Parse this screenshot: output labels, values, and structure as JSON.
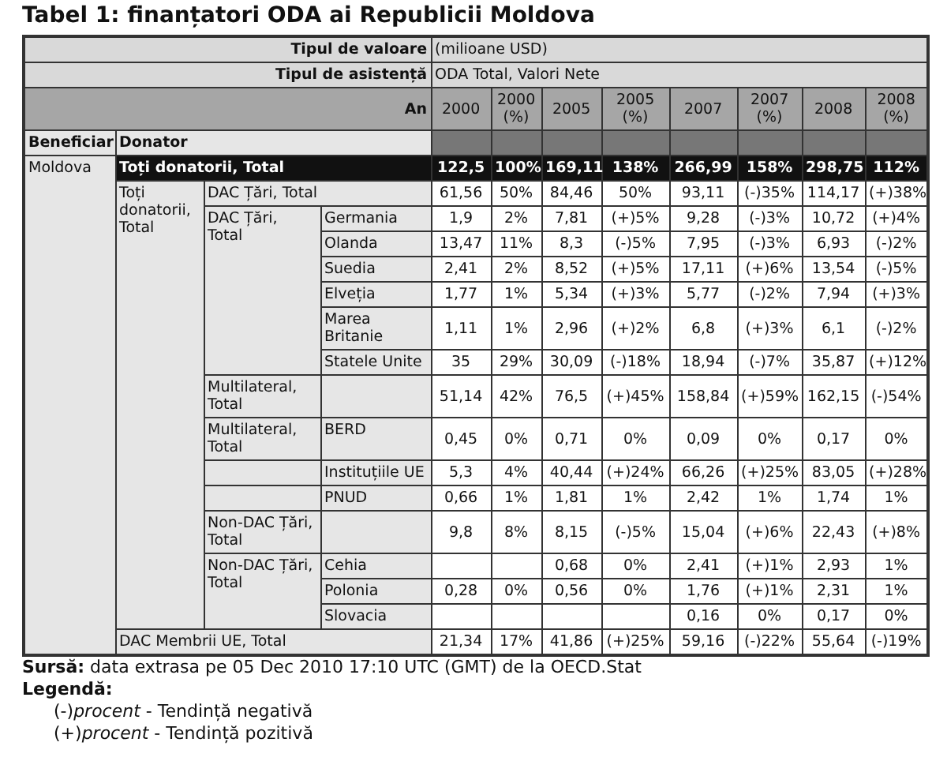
{
  "title": "Tabel 1: finanțatori ODA ai Republicii Moldova",
  "table": {
    "value_type": {
      "label": "Tipul de valoare",
      "value": "(milioane USD)"
    },
    "assistance_type": {
      "label": "Tipul de asistență",
      "value": "ODA Total, Valori Nete"
    },
    "year_label": "An",
    "columns": [
      "2000",
      "2000 (%)",
      "2005",
      "2005 (%)",
      "2007",
      "2007 (%)",
      "2008",
      "2008 (%)"
    ],
    "beneficiary_header": "Beneficiar",
    "donor_header": "Donator",
    "beneficiary": "Moldova",
    "rows": [
      {
        "label": "Toți donatorii, Total",
        "highlighted": true,
        "values": [
          "122,5",
          "100%",
          "169,11",
          "138%",
          "266,99",
          "158%",
          "298,75",
          "112%"
        ]
      },
      {
        "label": "Toți donatorii, Total",
        "highlighted": false,
        "children": [
          {
            "label": "DAC Țări, Total",
            "values": [
              "61,56",
              "50%",
              "84,46",
              "50%",
              "93,11",
              "(-)35%",
              "114,17",
              "(+)38%"
            ]
          },
          {
            "label": "DAC Țări, Total",
            "children": [
              {
                "label": "Germania",
                "values": [
                  "1,9",
                  "2%",
                  "7,81",
                  "(+)5%",
                  "9,28",
                  "(-)3%",
                  "10,72",
                  "(+)4%"
                ]
              },
              {
                "label": "Olanda",
                "values": [
                  "13,47",
                  "11%",
                  "8,3",
                  "(-)5%",
                  "7,95",
                  "(-)3%",
                  "6,93",
                  "(-)2%"
                ]
              },
              {
                "label": "Suedia",
                "values": [
                  "2,41",
                  "2%",
                  "8,52",
                  "(+)5%",
                  "17,11",
                  "(+)6%",
                  "13,54",
                  "(-)5%"
                ]
              },
              {
                "label": "Elveția",
                "values": [
                  "1,77",
                  "1%",
                  "5,34",
                  "(+)3%",
                  "5,77",
                  "(-)2%",
                  "7,94",
                  "(+)3%"
                ]
              },
              {
                "label": "Marea Britanie",
                "values": [
                  "1,11",
                  "1%",
                  "2,96",
                  "(+)2%",
                  "6,8",
                  "(+)3%",
                  "6,1",
                  "(-)2%"
                ]
              },
              {
                "label": "Statele Unite",
                "values": [
                  "35",
                  "29%",
                  "30,09",
                  "(-)18%",
                  "18,94",
                  "(-)7%",
                  "35,87",
                  "(+)12%"
                ]
              }
            ]
          },
          {
            "label": "Multilateral, Total",
            "children": [
              {
                "values": [
                  "51,14",
                  "42%",
                  "76,5",
                  "(+)45%",
                  "158,84",
                  "(+)59%",
                  "162,15",
                  "(-)54%"
                ]
              }
            ]
          },
          {
            "label": "Multilateral, Total",
            "children": [
              {
                "label": "BERD",
                "values": [
                  "0,45",
                  "0%",
                  "0,71",
                  "0%",
                  "0,09",
                  "0%",
                  "0,17",
                  "0%"
                ]
              }
            ]
          },
          {
            "children": [
              {
                "label": "Instituțiile UE",
                "values": [
                  "5,3",
                  "4%",
                  "40,44",
                  "(+)24%",
                  "66,26",
                  "(+)25%",
                  "83,05",
                  "(+)28%"
                ]
              }
            ]
          },
          {
            "children": [
              {
                "label": "PNUD",
                "values": [
                  "0,66",
                  "1%",
                  "1,81",
                  "1%",
                  "2,42",
                  "1%",
                  "1,74",
                  "1%"
                ]
              }
            ]
          },
          {
            "label": "Non-DAC Țări, Total",
            "children": [
              {
                "values": [
                  "9,8",
                  "8%",
                  "8,15",
                  "(-)5%",
                  "15,04",
                  "(+)6%",
                  "22,43",
                  "(+)8%"
                ]
              }
            ]
          },
          {
            "label": "Non-DAC Țări, Total",
            "children": [
              {
                "label": "Cehia",
                "values": [
                  {
                    "kind": "blank"
                  },
                  {
                    "kind": "blank"
                  },
                  "0,68",
                  "0%",
                  "2,41",
                  "(+)1%",
                  "2,93",
                  "1%"
                ]
              },
              {
                "label": "Polonia",
                "values": [
                  "0,28",
                  "0%",
                  "0,56",
                  "0%",
                  "1,76",
                  "(+)1%",
                  "2,31",
                  "1%"
                ]
              },
              {
                "label": "Slovacia",
                "values": [
                  {
                    "kind": "blank"
                  },
                  {
                    "kind": "blank"
                  },
                  {
                    "kind": "blank"
                  },
                  {
                    "kind": "blank"
                  },
                  "0,16",
                  "0%",
                  "0,17",
                  "0%"
                ]
              }
            ]
          }
        ]
      },
      {
        "label": "DAC Membrii UE, Total",
        "highlighted": false,
        "values": [
          "21,34",
          "17%",
          "41,86",
          "(+)25%",
          "59,16",
          "(-)22%",
          "55,64",
          "(-)19%"
        ]
      }
    ]
  },
  "source": "**Sursă:** data extrasa pe 05 Dec 2010 17:10 UTC (GMT) de la OECD.Stat",
  "legend": {
    "title": "Legendă:",
    "items": [
      "(-)*procent* - Tendință negativă",
      "(+)*procent* - Tendință pozitivă"
    ]
  }
}
